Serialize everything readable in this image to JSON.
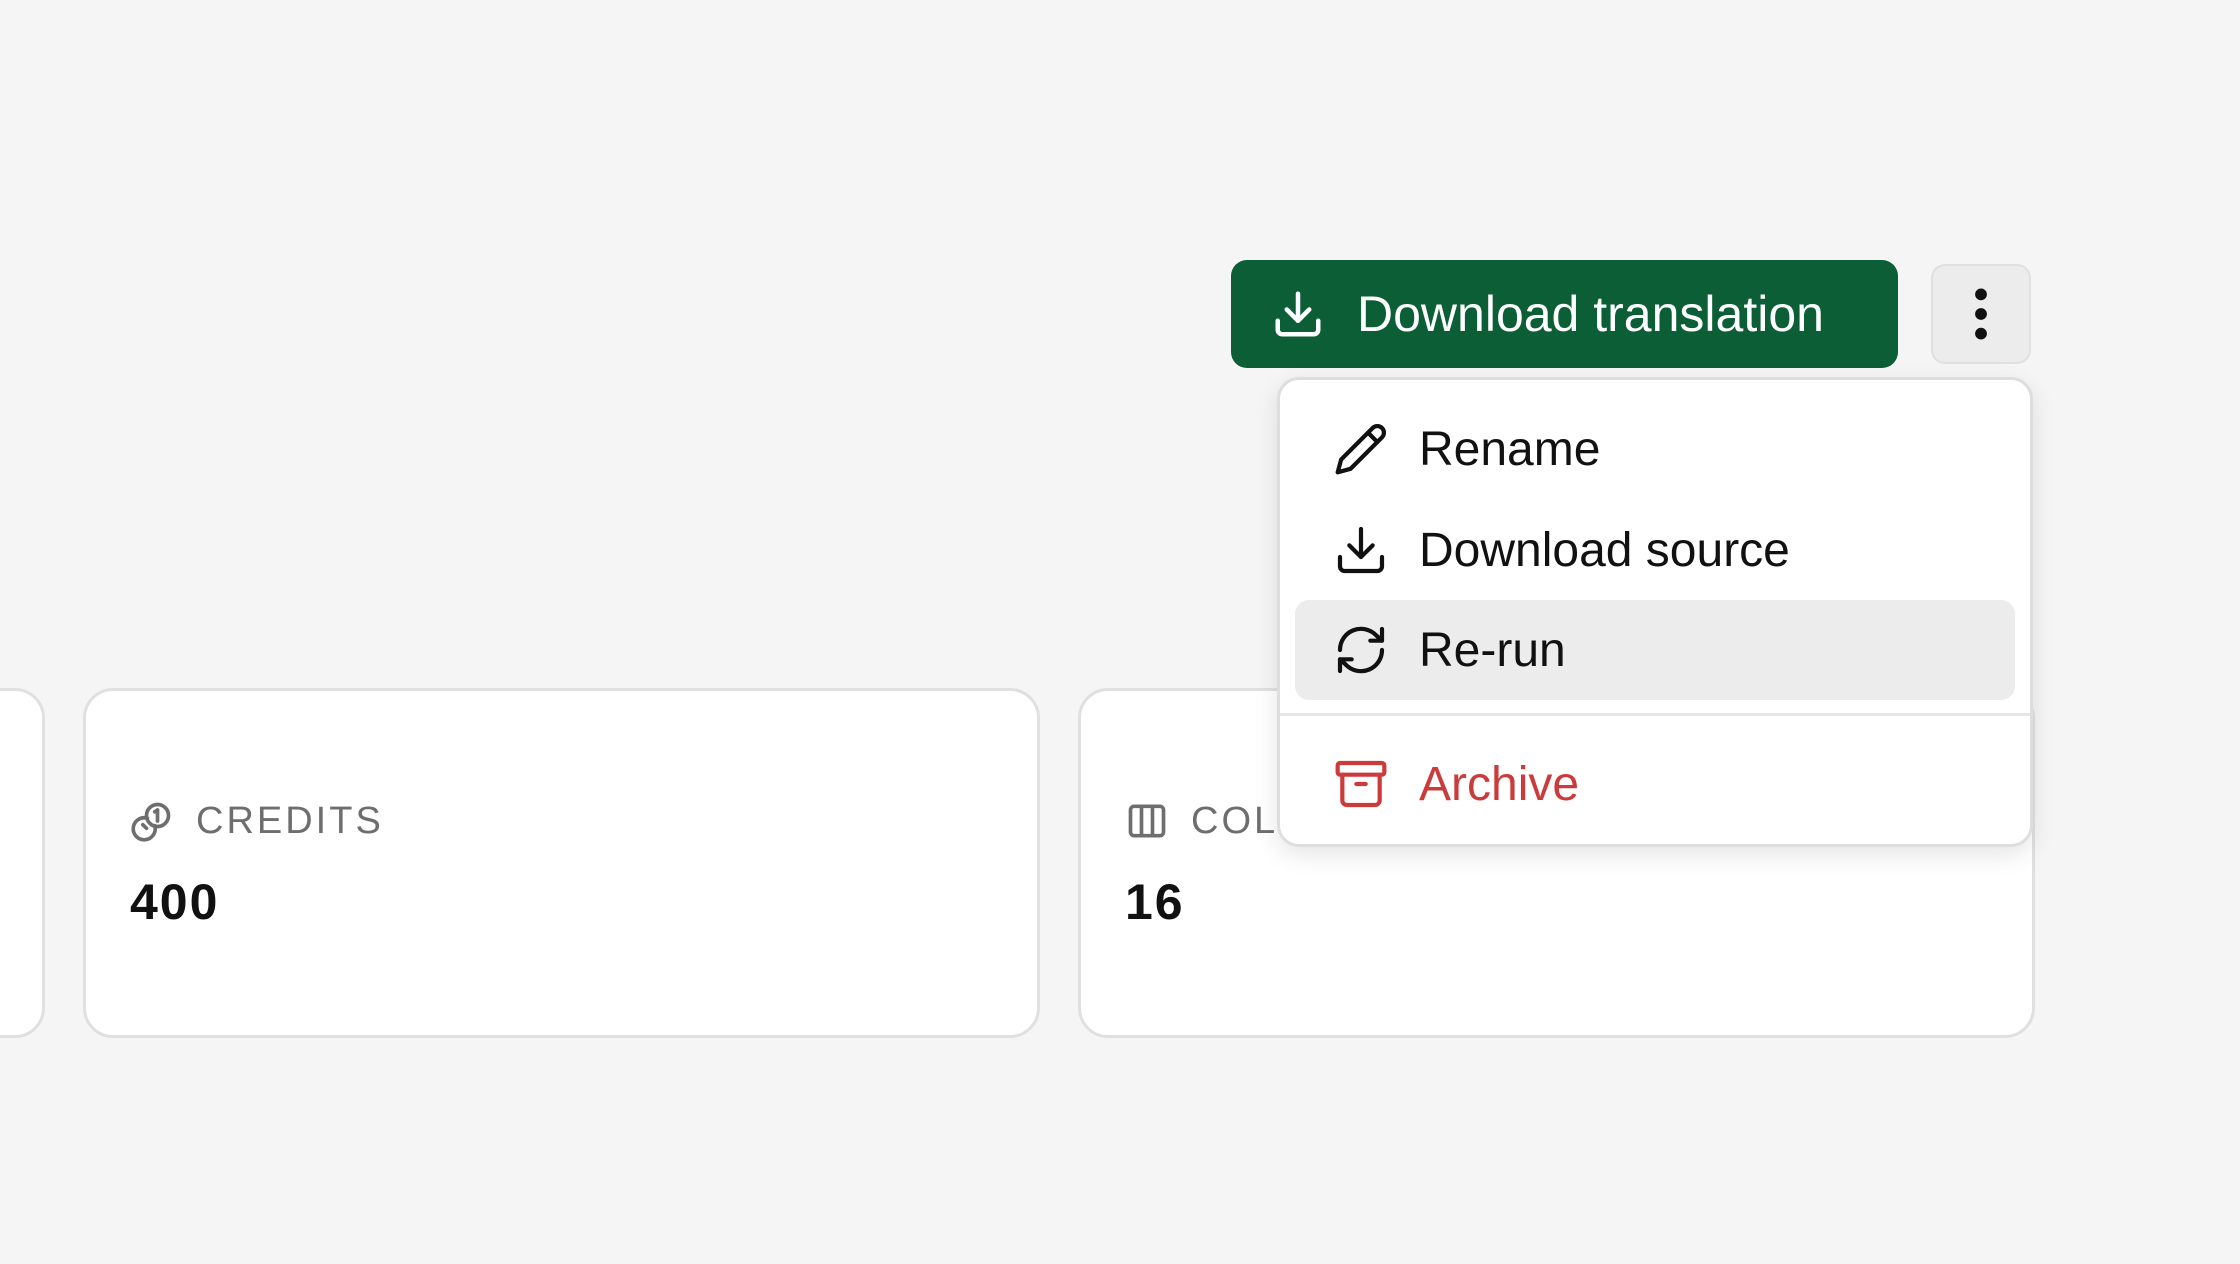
{
  "header": {
    "primary_action_label": "Download translation",
    "primary_action_icon": "download-icon",
    "more_button_icon": "more-vertical-icon"
  },
  "menu": {
    "items": [
      {
        "label": "Rename",
        "icon": "pencil-icon"
      },
      {
        "label": "Download source",
        "icon": "download-icon"
      },
      {
        "label": "Re-run",
        "icon": "refresh-icon"
      },
      {
        "label": "Archive",
        "icon": "archive-icon"
      }
    ]
  },
  "stats": {
    "credits": {
      "label": "CREDITS",
      "value": "400",
      "icon": "coins-icon"
    },
    "columns": {
      "label": "COLU",
      "value": "16",
      "icon": "columns-icon"
    }
  },
  "colors": {
    "primary": "#0b5e35",
    "danger": "#cc3b3b",
    "background": "#f5f5f5",
    "hover": "#ececec"
  }
}
